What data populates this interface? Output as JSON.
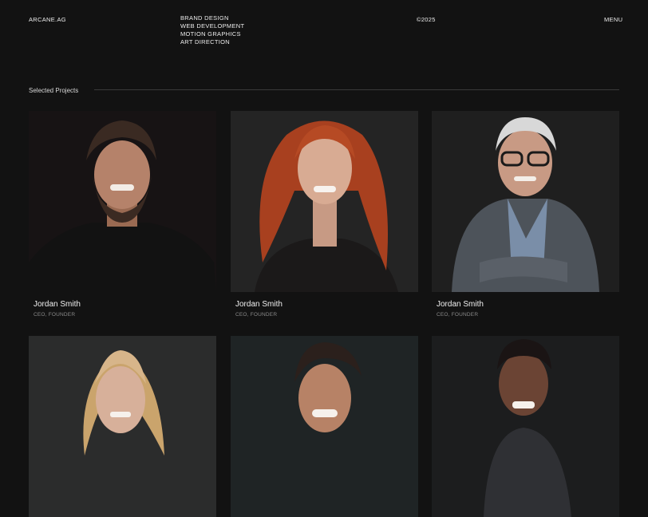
{
  "header": {
    "brand": "ARCANE.AG",
    "services": [
      "BRAND DESIGN",
      "WEB DEVELOPMENT",
      "MOTION GRAPHICS",
      "ART DIRECTION"
    ],
    "copyright": "©2025",
    "menu_label": "MENU"
  },
  "section": {
    "title": "Selected Projects"
  },
  "team": [
    {
      "name": "Jordan Smith",
      "role": "CEO, FOUNDER",
      "photo": "portrait-bearded-man-black-tee",
      "bg": "#1a1516"
    },
    {
      "name": "Jordan Smith",
      "role": "CEO, FOUNDER",
      "photo": "portrait-red-haired-woman",
      "bg": "#232323"
    },
    {
      "name": "Jordan Smith",
      "role": "CEO, FOUNDER",
      "photo": "portrait-older-man-glasses-plaid-blazer",
      "bg": "#1f1f1f"
    },
    {
      "photo": "portrait-blonde-woman",
      "bg": "#2a2b2b"
    },
    {
      "photo": "portrait-smiling-man-dark-hair",
      "bg": "#1f2324"
    },
    {
      "photo": "portrait-smiling-man-short-afro",
      "bg": "#1c1d1e"
    }
  ]
}
